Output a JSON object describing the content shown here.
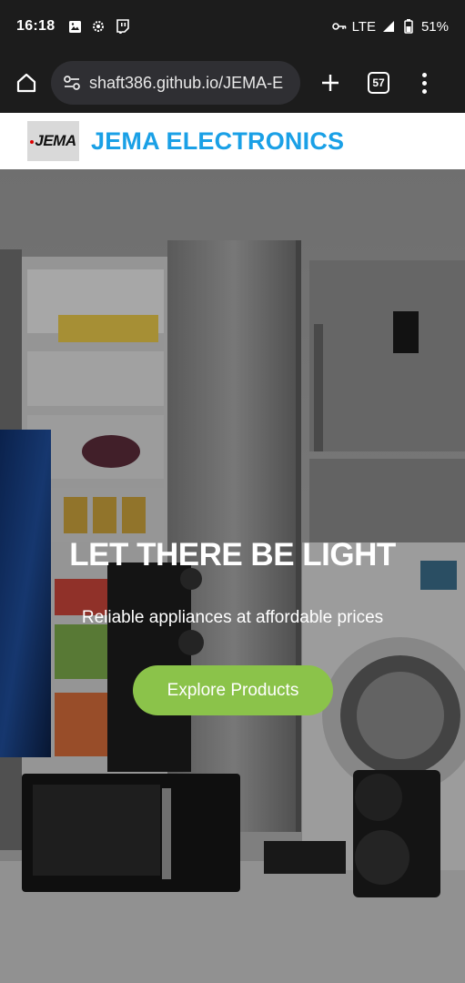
{
  "status_bar": {
    "time": "16:18",
    "network": "LTE",
    "battery": "51%"
  },
  "browser": {
    "url": "shaft386.github.io/JEMA-E",
    "tab_count": "57"
  },
  "site": {
    "logo_text": "JEMA",
    "brand_name": "JEMA ELECTRONICS",
    "brand_color": "#1aa0e6"
  },
  "hero": {
    "title": "LET THERE BE LIGHT",
    "subtitle": "Reliable appliances at affordable prices",
    "cta_label": "Explore Products",
    "cta_color": "#8bc34a"
  }
}
